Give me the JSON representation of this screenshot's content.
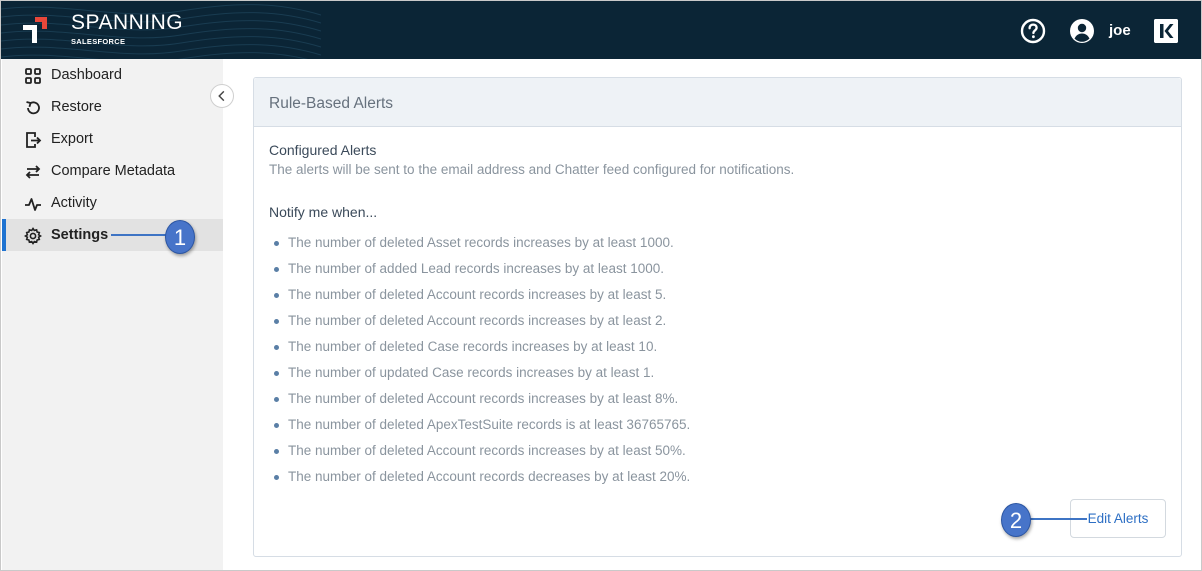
{
  "header": {
    "brand": "SPANNING",
    "brand_sub": "SALESFORCE",
    "username": "joe",
    "colors": {
      "background": "#0b2536",
      "accent_red": "#e8473a"
    }
  },
  "sidebar": {
    "items": [
      {
        "label": "Dashboard",
        "icon": "grid-icon"
      },
      {
        "label": "Restore",
        "icon": "restore-icon"
      },
      {
        "label": "Export",
        "icon": "export-icon"
      },
      {
        "label": "Compare Metadata",
        "icon": "swap-arrows-icon"
      },
      {
        "label": "Activity",
        "icon": "activity-icon"
      },
      {
        "label": "Settings",
        "icon": "gear-icon",
        "active": true
      }
    ],
    "active_color": "#1f73d1"
  },
  "callouts": {
    "one": "1",
    "two": "2"
  },
  "panel": {
    "title": "Rule-Based Alerts",
    "configured_title": "Configured Alerts",
    "configured_desc": "The alerts will be sent to the email address and Chatter feed configured for notifications.",
    "notify_label": "Notify me when...",
    "alerts": [
      "The number of deleted Asset records increases by at least 1000.",
      "The number of added Lead records increases by at least 1000.",
      "The number of deleted Account records increases by at least 5.",
      "The number of deleted Account records increases by at least 2.",
      "The number of deleted Case records increases by at least 10.",
      "The number of updated Case records increases by at least 1.",
      "The number of deleted Account records increases by at least 8%.",
      "The number of deleted ApexTestSuite records is at least 36765765.",
      "The number of deleted Account records increases by at least 50%.",
      "The number of deleted Account records decreases by at least 20%."
    ],
    "edit_button": "Edit Alerts"
  }
}
